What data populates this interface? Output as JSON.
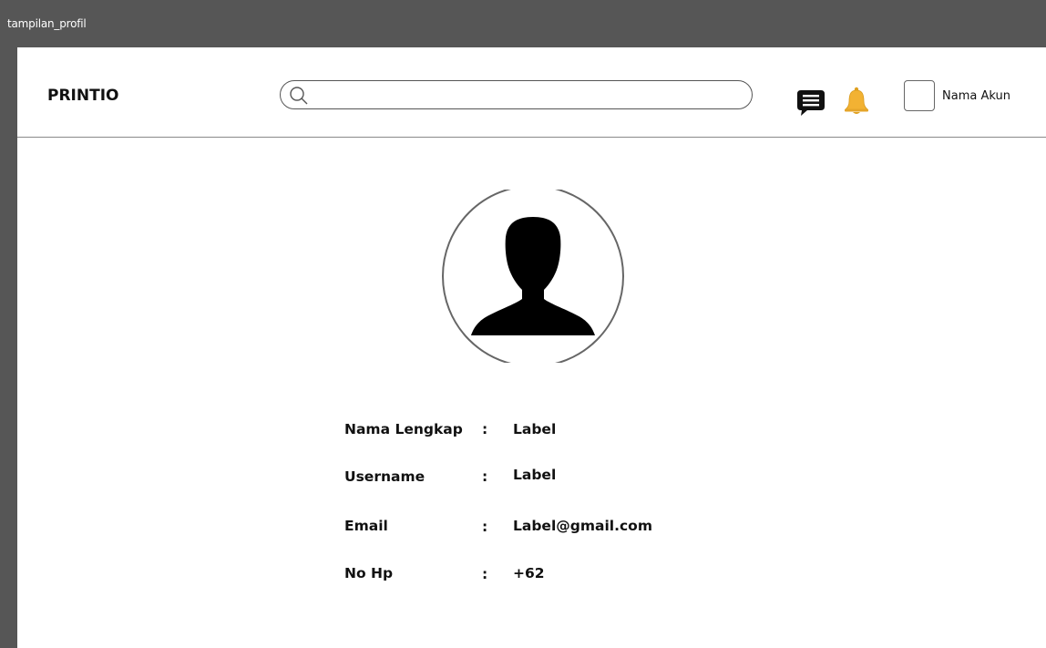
{
  "window": {
    "title": "tampilan_profil"
  },
  "header": {
    "brand": "PRINTIO",
    "search_placeholder": "",
    "icons": [
      "search-icon",
      "chat-icon",
      "bell-icon"
    ],
    "account_name": "Nama Akun"
  },
  "profile": {
    "avatar_icon": "user-silhouette-icon",
    "rows": [
      {
        "label": "Nama Lengkap",
        "colon": ":",
        "value": "Label"
      },
      {
        "label": "Username",
        "colon": ":",
        "value": "Label"
      },
      {
        "label": "Email",
        "colon": ":",
        "value": "Label@gmail.com"
      },
      {
        "label": "No Hp",
        "colon": ":",
        "value": "+62"
      }
    ]
  },
  "colors": {
    "titlebar": "#565656",
    "bell": "#f2b233",
    "text": "#111111"
  }
}
